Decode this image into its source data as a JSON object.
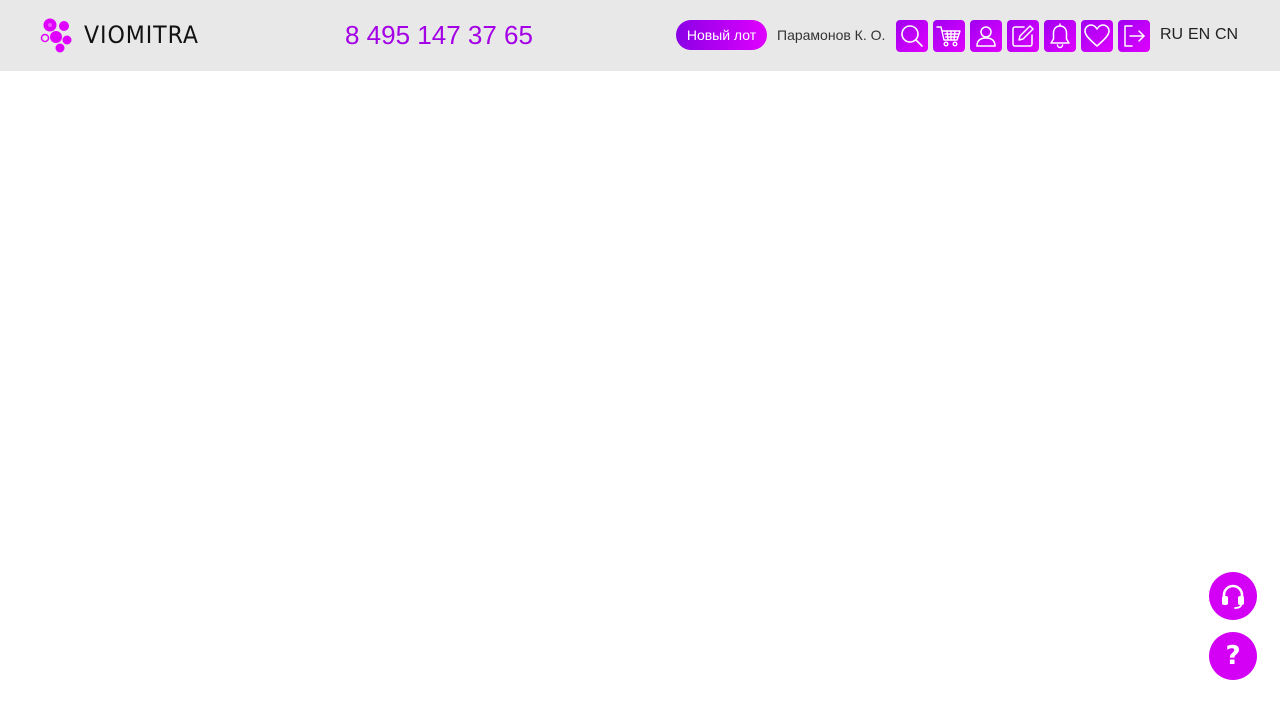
{
  "brand": {
    "name": "VIOMITRA",
    "logo_icon": "molecule-icon",
    "accent_color": "#c400ff"
  },
  "header": {
    "phone": "8 495 147 37 65",
    "new_lot_label": "Новый лот",
    "user_name": "Парамонов К. О.",
    "actions": [
      {
        "icon": "search-icon"
      },
      {
        "icon": "cart-icon"
      },
      {
        "icon": "user-icon"
      },
      {
        "icon": "edit-icon"
      },
      {
        "icon": "bell-icon"
      },
      {
        "icon": "heart-icon"
      },
      {
        "icon": "logout-icon"
      }
    ],
    "languages": [
      "RU",
      "EN",
      "CN"
    ]
  },
  "floating": {
    "support_icon": "headset-icon",
    "help_label": "?"
  }
}
